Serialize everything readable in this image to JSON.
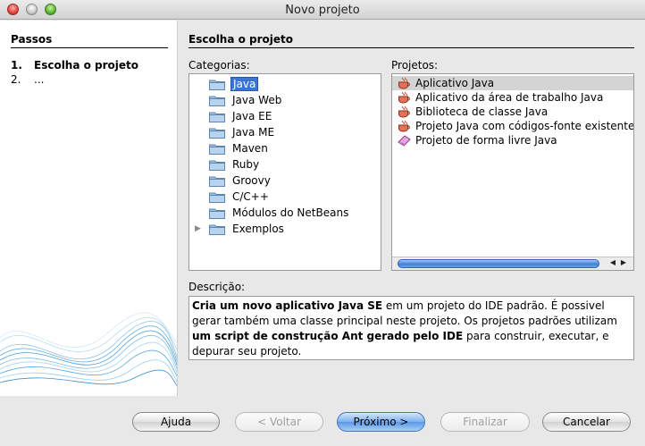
{
  "window": {
    "title": "Novo projeto"
  },
  "steps": {
    "heading": "Passos",
    "items": [
      {
        "num": "1.",
        "label": "Escolha o projeto"
      },
      {
        "num": "2.",
        "label": "..."
      }
    ]
  },
  "main": {
    "heading": "Escolha o projeto"
  },
  "categories": {
    "label": "Categorias:",
    "items": [
      {
        "label": "Java",
        "selected": true
      },
      {
        "label": "Java Web"
      },
      {
        "label": "Java EE"
      },
      {
        "label": "Java ME"
      },
      {
        "label": "Maven"
      },
      {
        "label": "Ruby"
      },
      {
        "label": "Groovy"
      },
      {
        "label": "C/C++"
      },
      {
        "label": "Módulos do NetBeans"
      },
      {
        "label": "Exemplos",
        "expandable": true
      }
    ]
  },
  "projects": {
    "label": "Projetos:",
    "items": [
      {
        "label": "Aplicativo Java",
        "icon": "java-cup-icon",
        "selected": true
      },
      {
        "label": "Aplicativo da área de trabalho Java",
        "icon": "java-cup-icon"
      },
      {
        "label": "Biblioteca de classe Java",
        "icon": "java-cup-icon"
      },
      {
        "label": "Projeto Java com códigos-fonte existentes",
        "icon": "java-cup-icon"
      },
      {
        "label": "Projeto de forma livre Java",
        "icon": "freeform-project-icon"
      }
    ]
  },
  "description": {
    "label": "Descrição:",
    "segments": [
      {
        "text": "Cria um novo aplicativo Java SE",
        "bold": true
      },
      {
        "text": " em um projeto do IDE padrão. É possivel gerar também uma classe principal neste projeto. Os projetos padrões utilizam ",
        "bold": false
      },
      {
        "text": "um script de construção Ant gerado pelo IDE",
        "bold": true
      },
      {
        "text": " para construir, executar, e depurar seu projeto.",
        "bold": false
      }
    ]
  },
  "buttons": {
    "help": "Ajuda",
    "back": "< Voltar",
    "next": "Próximo >",
    "finish": "Finalizar",
    "cancel": "Cancelar"
  },
  "colors": {
    "selection": "#3875d7",
    "default_button": "#5b98e6"
  }
}
